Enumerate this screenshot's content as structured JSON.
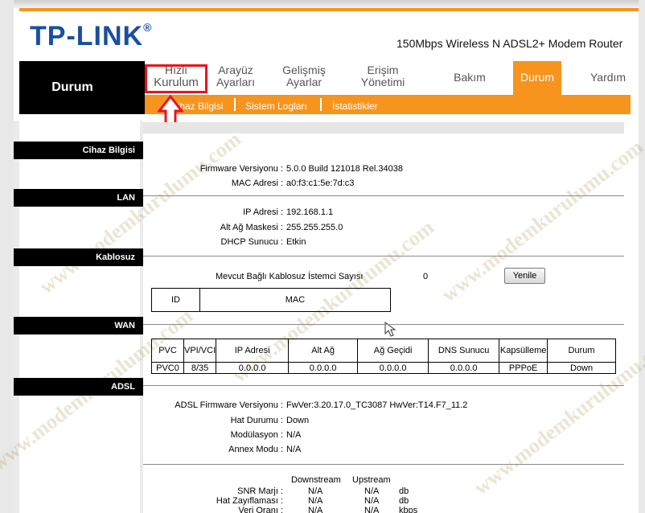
{
  "brand": {
    "logo": "TP-LINK",
    "logo_mark": "®",
    "model": "150Mbps Wireless N ADSL2+ Modem Router"
  },
  "nav": {
    "current_section": "Durum",
    "items": [
      {
        "line1": "Hızlı",
        "line2": "Kurulum"
      },
      {
        "line1": "Arayüz",
        "line2": "Ayarları"
      },
      {
        "line1": "Gelişmiş",
        "line2": "Ayarlar"
      },
      {
        "line1": "Erişim",
        "line2": "Yönetimi"
      },
      {
        "line1": "Bakım",
        "line2": ""
      },
      {
        "line1": "Durum",
        "line2": ""
      },
      {
        "line1": "Yardım",
        "line2": ""
      }
    ],
    "active": "Durum",
    "subtabs": [
      "Cihaz Bilgisi",
      "Sistem Logları",
      "İstatistikler"
    ]
  },
  "sections": {
    "cihaz": {
      "title": "Cihaz Bilgisi",
      "fields": [
        {
          "label": "Firmware Versiyonu :",
          "value": "5.0.0 Build 121018 Rel.34038"
        },
        {
          "label": "MAC Adresi :",
          "value": "a0:f3:c1:5e:7d:c3"
        }
      ]
    },
    "lan": {
      "title": "LAN",
      "fields": [
        {
          "label": "IP Adresi :",
          "value": "192.168.1.1"
        },
        {
          "label": "Alt Ağ Maskesi :",
          "value": "255.255.255.0"
        },
        {
          "label": "DHCP Sunucu :",
          "value": "Etkin"
        }
      ]
    },
    "kablosuz": {
      "title": "Kablosuz",
      "clients_label": "Mevcut Bağlı Kablosuz İstemci Sayısı",
      "clients_count": "0",
      "refresh_button": "Yenile",
      "table_headers": [
        "ID",
        "MAC"
      ]
    },
    "wan": {
      "title": "WAN",
      "headers": [
        "PVC",
        "VPI/VCI",
        "IP Adresi",
        "Alt Ağ",
        "Ağ Geçidi",
        "DNS Sunucu",
        "Kapsülleme",
        "Durum"
      ],
      "rows": [
        [
          "PVC0",
          "8/35",
          "0.0.0.0",
          "0.0.0.0",
          "0.0.0.0",
          "0.0.0.0",
          "PPPoE",
          "Down"
        ]
      ]
    },
    "adsl": {
      "title": "ADSL",
      "fields": [
        {
          "label": "ADSL Firmware Versiyonu :",
          "value": "FwVer:3.20.17.0_TC3087 HwVer:T14.F7_11.2"
        },
        {
          "label": "Hat Durumu :",
          "value": "Down"
        },
        {
          "label": "Modülasyon :",
          "value": "N/A"
        },
        {
          "label": "Annex Modu :",
          "value": "N/A"
        }
      ],
      "stats_headers": [
        "Downstream",
        "Upstream"
      ],
      "stats": [
        {
          "label": "SNR Marjı :",
          "down": "N/A",
          "up": "N/A",
          "unit": "db"
        },
        {
          "label": "Hat Zayıflaması :",
          "down": "N/A",
          "up": "N/A",
          "unit": "db"
        },
        {
          "label": "Veri Oranı :",
          "down": "N/A",
          "up": "N/A",
          "unit": "kbps"
        }
      ]
    }
  },
  "colors": {
    "accent": "#f7941d",
    "brand_blue": "#1a4fa0",
    "highlight": "#e8141b"
  }
}
